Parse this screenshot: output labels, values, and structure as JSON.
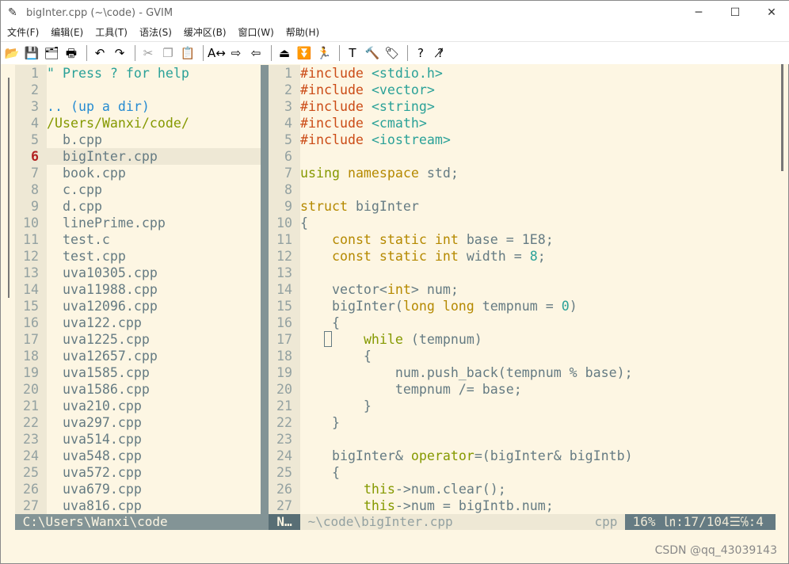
{
  "window": {
    "title": "bigInter.cpp (~\\code) - GVIM",
    "icon": "vim-icon",
    "controls": [
      "─",
      "☐",
      "✕"
    ]
  },
  "menu": [
    "文件(F)",
    "编辑(E)",
    "工具(T)",
    "语法(S)",
    "缓冲区(B)",
    "窗口(W)",
    "帮助(H)"
  ],
  "toolbar": [
    {
      "name": "open-icon",
      "glyph": "📂"
    },
    {
      "name": "save-icon",
      "glyph": "💾"
    },
    {
      "name": "save-all-icon",
      "glyph": "🗂"
    },
    {
      "name": "print-icon",
      "glyph": "🖶"
    },
    "sep",
    {
      "name": "undo-icon",
      "glyph": "↶"
    },
    {
      "name": "redo-icon",
      "glyph": "↷"
    },
    "sep",
    {
      "name": "cut-icon",
      "glyph": "✂",
      "dim": true
    },
    {
      "name": "copy-icon",
      "glyph": "❐",
      "dim": true
    },
    {
      "name": "paste-icon",
      "glyph": "📋"
    },
    "sep",
    {
      "name": "replace-icon",
      "glyph": "A↔"
    },
    {
      "name": "find-next-icon",
      "glyph": "⇨"
    },
    {
      "name": "find-prev-icon",
      "glyph": "⇦"
    },
    "sep",
    {
      "name": "load-session-icon",
      "glyph": "⏏"
    },
    {
      "name": "save-session-icon",
      "glyph": "⏬"
    },
    {
      "name": "run-script-icon",
      "glyph": "🏃"
    },
    "sep",
    {
      "name": "make-icon",
      "glyph": "T"
    },
    {
      "name": "build-tags-icon",
      "glyph": "🔨"
    },
    {
      "name": "jump-tag-icon",
      "glyph": "🏷"
    },
    "sep",
    {
      "name": "help-icon",
      "glyph": "?"
    },
    {
      "name": "find-help-icon",
      "glyph": "?̸"
    }
  ],
  "colors": {
    "bg": "#fdf6e3",
    "comment": "#2aa198",
    "dir": "#268bd2",
    "path": "#859900",
    "preproc": "#cb4b16",
    "string": "#2aa198",
    "keyword": "#b58900",
    "statement": "#859900",
    "number": "#2aa198"
  },
  "explorer": {
    "current_line": 6,
    "lines": [
      [
        [
          "\" Press ? for help",
          "comment"
        ]
      ],
      [],
      [
        [
          ".. (up a dir)",
          "dir"
        ]
      ],
      [
        [
          "/Users/Wanxi/code/",
          "path"
        ]
      ],
      [
        [
          "  b.cpp",
          ""
        ]
      ],
      [
        [
          "  bigInter.cpp",
          ""
        ]
      ],
      [
        [
          "  book.cpp",
          ""
        ]
      ],
      [
        [
          "  c.cpp",
          ""
        ]
      ],
      [
        [
          "  d.cpp",
          ""
        ]
      ],
      [
        [
          "  linePrime.cpp",
          ""
        ]
      ],
      [
        [
          "  test.c",
          ""
        ]
      ],
      [
        [
          "  test.cpp",
          ""
        ]
      ],
      [
        [
          "  uva10305.cpp",
          ""
        ]
      ],
      [
        [
          "  uva11988.cpp",
          ""
        ]
      ],
      [
        [
          "  uva12096.cpp",
          ""
        ]
      ],
      [
        [
          "  uva122.cpp",
          ""
        ]
      ],
      [
        [
          "  uva1225.cpp",
          ""
        ]
      ],
      [
        [
          "  uva12657.cpp",
          ""
        ]
      ],
      [
        [
          "  uva1585.cpp",
          ""
        ]
      ],
      [
        [
          "  uva1586.cpp",
          ""
        ]
      ],
      [
        [
          "  uva210.cpp",
          ""
        ]
      ],
      [
        [
          "  uva297.cpp",
          ""
        ]
      ],
      [
        [
          "  uva514.cpp",
          ""
        ]
      ],
      [
        [
          "  uva548.cpp",
          ""
        ]
      ],
      [
        [
          "  uva572.cpp",
          ""
        ]
      ],
      [
        [
          "  uva679.cpp",
          ""
        ]
      ],
      [
        [
          "  uva816.cpp",
          ""
        ]
      ]
    ]
  },
  "editor": {
    "lines": [
      [
        [
          "#include",
          "preproc"
        ],
        [
          " ",
          ""
        ],
        [
          "<stdio.h>",
          "string"
        ]
      ],
      [
        [
          "#include",
          "preproc"
        ],
        [
          " ",
          ""
        ],
        [
          "<vector>",
          "string"
        ]
      ],
      [
        [
          "#include",
          "preproc"
        ],
        [
          " ",
          ""
        ],
        [
          "<string>",
          "string"
        ]
      ],
      [
        [
          "#include",
          "preproc"
        ],
        [
          " ",
          ""
        ],
        [
          "<cmath>",
          "string"
        ]
      ],
      [
        [
          "#include",
          "preproc"
        ],
        [
          " ",
          ""
        ],
        [
          "<iostream>",
          "string"
        ]
      ],
      [],
      [
        [
          "using",
          "statement"
        ],
        [
          " ",
          ""
        ],
        [
          "namespace",
          "keyword"
        ],
        [
          " std;",
          ""
        ]
      ],
      [],
      [
        [
          "struct",
          "keyword"
        ],
        [
          " bigInter",
          ""
        ]
      ],
      [
        [
          "{",
          ""
        ]
      ],
      [
        [
          "    ",
          ""
        ],
        [
          "const static int",
          "keyword"
        ],
        [
          " base = 1E8;",
          ""
        ]
      ],
      [
        [
          "    ",
          ""
        ],
        [
          "const static int",
          "keyword"
        ],
        [
          " width = ",
          ""
        ],
        [
          "8",
          "number"
        ],
        [
          ";",
          ""
        ]
      ],
      [],
      [
        [
          "    vector<",
          ""
        ],
        [
          "int",
          "keyword"
        ],
        [
          "> num;",
          ""
        ]
      ],
      [
        [
          "    bigInter(",
          ""
        ],
        [
          "long long",
          "keyword"
        ],
        [
          " tempnum = ",
          ""
        ],
        [
          "0",
          "number"
        ],
        [
          ")",
          ""
        ]
      ],
      [
        [
          "    {",
          ""
        ]
      ],
      [
        [
          "        ",
          ""
        ],
        [
          "while",
          "statement"
        ],
        [
          " (tempnum)",
          ""
        ]
      ],
      [
        [
          "        {",
          ""
        ]
      ],
      [
        [
          "            num.push_back(tempnum % base);",
          ""
        ]
      ],
      [
        [
          "            tempnum /= base;",
          ""
        ]
      ],
      [
        [
          "        }",
          ""
        ]
      ],
      [
        [
          "    }",
          ""
        ]
      ],
      [],
      [
        [
          "    bigInter& ",
          ""
        ],
        [
          "operator",
          "statement"
        ],
        [
          "=(bigInter& bigIntb)",
          ""
        ]
      ],
      [
        [
          "    {",
          ""
        ]
      ],
      [
        [
          "        ",
          ""
        ],
        [
          "this",
          "statement"
        ],
        [
          "->num.clear();",
          ""
        ]
      ],
      [
        [
          "        ",
          ""
        ],
        [
          "this",
          "statement"
        ],
        [
          "->num = bigIntb.num;",
          ""
        ]
      ]
    ]
  },
  "statusline": {
    "left": " C:\\Users\\Wanxi\\code",
    "mode": "N…",
    "file": " ~\\code\\bigInter.cpp",
    "filetype": "cpp ",
    "position": " 16% ㏑:17/104☰℅:4 "
  },
  "watermark": "CSDN @qq_43039143"
}
